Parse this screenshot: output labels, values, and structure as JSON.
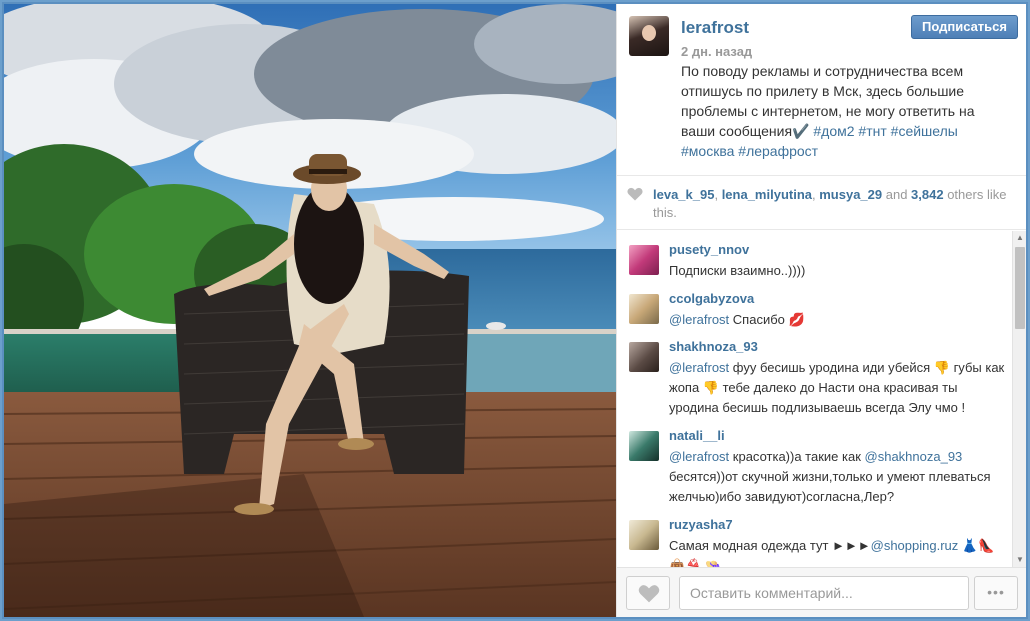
{
  "post": {
    "username": "lerafrost",
    "time_ago": "2 дн. назад",
    "follow_label": "Подписаться",
    "caption_text": "По поводу рекламы и сотрудничества всем отпишусь по прилету в Мск, здесь большие проблемы с интернетом, не могу ответить на ваши сообщения",
    "caption_emoji": "✔️",
    "hashtags": [
      "#дом2",
      "#тнт",
      "#сейшелы",
      "#москва",
      "#лерафрост"
    ]
  },
  "likes": {
    "users": [
      "leva_k_95",
      "lena_milyutina",
      "musya_29"
    ],
    "sep1": ", ",
    "sep2": ", ",
    "and_word": " and ",
    "count": "3,842",
    "suffix": " others like this."
  },
  "comments": [
    {
      "username": "pusety_nnov",
      "text": "Подписки взаимно..))))"
    },
    {
      "username": "ccolgabyzova",
      "mention": "@lerafrost",
      "text": " Спасибо ",
      "emoji": "💋"
    },
    {
      "username": "shakhnoza_93",
      "mention": "@lerafrost",
      "text_a": " фуу бесишь уродина иди убейся ",
      "emoji_a": "👎",
      "text_b": " губы как жопа ",
      "emoji_b": "👎",
      "text_c": " тебе далеко до Насти она красивая ты уродина бесишь подлизываешь всегда Элу чмо !"
    },
    {
      "username": "natali__li",
      "mention": "@lerafrost",
      "text_a": " красотка))а такие как ",
      "mention2": "@shakhnoza_93",
      "text_b": " бесятся))от скучной жизни,только и умеют плеваться желчью)ибо завидуют)согласна,Лер?"
    },
    {
      "username": "ruzyasha7",
      "text": "Самая модная одежда тут ►►►",
      "mention": "@shopping.ruz",
      "emoji": " 👗👠👜👙 👒"
    }
  ],
  "footer": {
    "comment_placeholder": "Оставить комментарий...",
    "more_label": "•••"
  },
  "colors": {
    "accent": "#3f729b",
    "frame": "#5b8fc0",
    "follow_button": "#4e7fb6"
  },
  "icons": {
    "like_small": "heart-icon",
    "like_button": "heart-icon",
    "more": "ellipsis-icon"
  }
}
